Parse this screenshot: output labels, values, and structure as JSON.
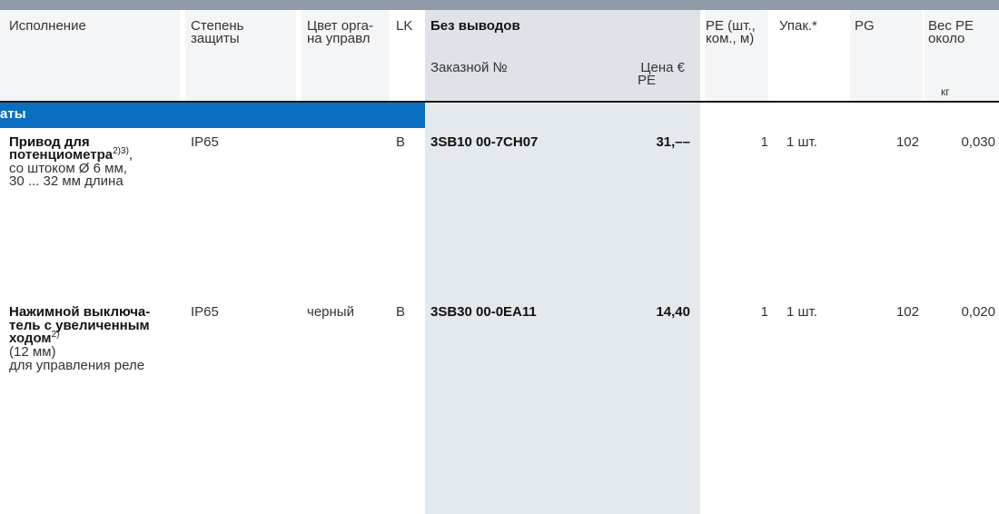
{
  "header": {
    "col1": [
      "Исполнение"
    ],
    "col2": [
      "Степень",
      "защиты"
    ],
    "col3": [
      "Цвет орга-",
      "на управл"
    ],
    "col4": [
      "LK"
    ],
    "col5_title": "Без выводов",
    "col5_order": "Заказной №",
    "col5_price": [
      "Цена €",
      "PE"
    ],
    "col6": [
      "PE (шт.,",
      "ком., м)"
    ],
    "col7": [
      "Упак.*"
    ],
    "col8": [
      "PG"
    ],
    "col9": [
      "Вес PE",
      "около"
    ],
    "col9_unit": "кг"
  },
  "section_title": "аты",
  "rows": [
    {
      "name_bold": [
        "Привод для",
        "потенциометра"
      ],
      "name_sup": "2)3)",
      "name_tail": ",",
      "name_rest": [
        "со штоком Ø 6 мм,",
        "30 ... 32 мм длина"
      ],
      "protection": "IP65",
      "color": "",
      "lk": "B",
      "order_no": "3SB10 00-7CH07",
      "price": "31,––",
      "pe": "1",
      "pack": "1 шт.",
      "pg": "102",
      "weight": "0,030"
    },
    {
      "name_bold": [
        "Нажимной выключа-",
        "тель с увеличенным",
        "ходом"
      ],
      "name_sup": "2)",
      "name_tail": "",
      "name_rest": [
        "(12 мм)",
        "для управления реле"
      ],
      "protection": "IP65",
      "color": "черный",
      "lk": "B",
      "order_no": "3SB30 00-0EA11",
      "price": "14,40",
      "pe": "1",
      "pack": "1 шт.",
      "pg": "102",
      "weight": "0,020"
    }
  ]
}
